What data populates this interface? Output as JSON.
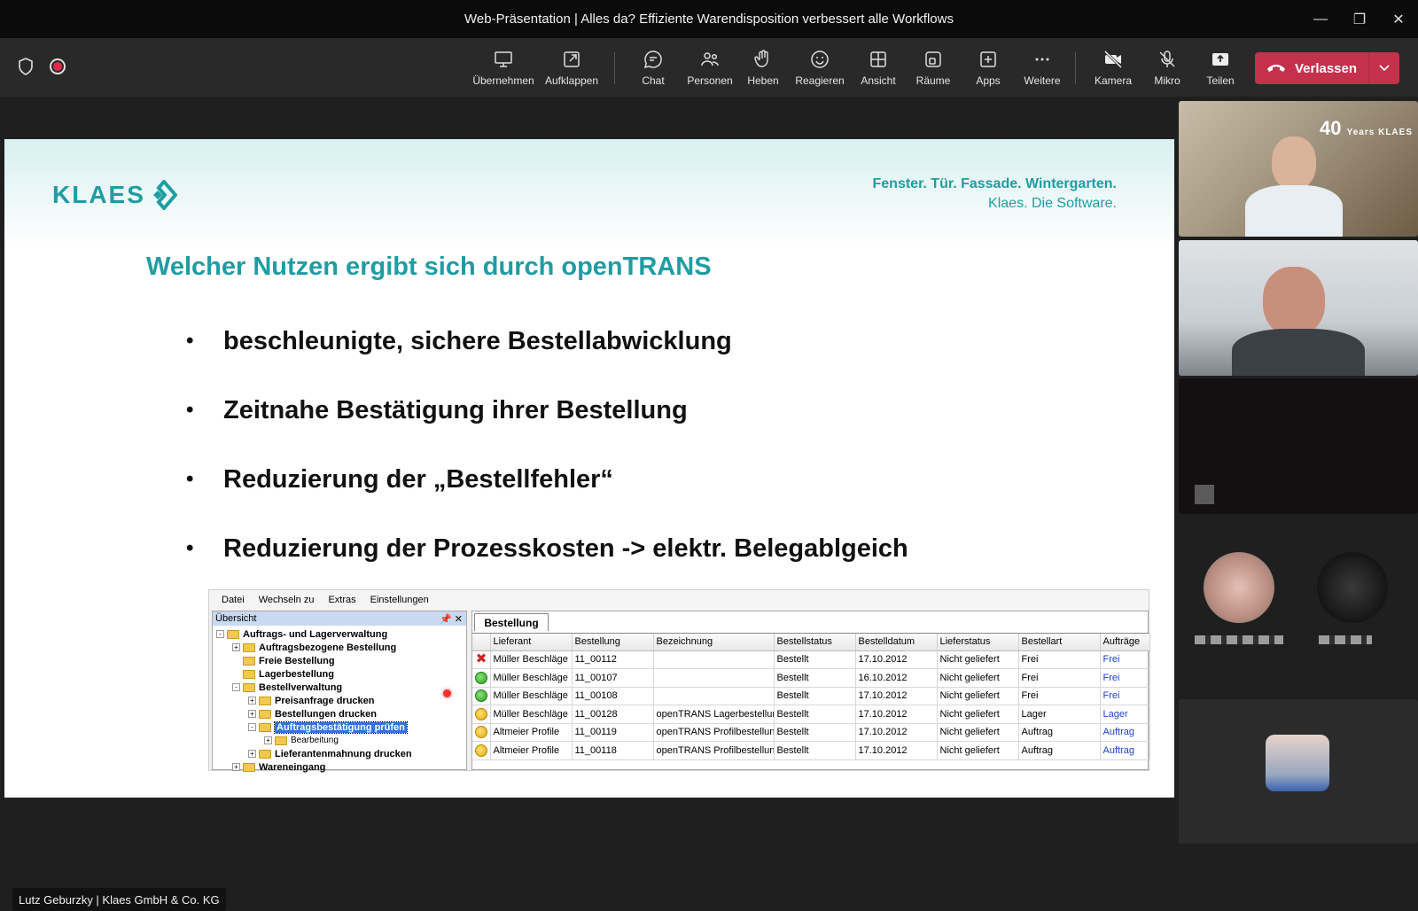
{
  "window": {
    "title": "Web-Präsentation | Alles da? Effiziente Warendisposition verbessert alle Workflows",
    "controls": [
      "minimize",
      "restore",
      "close"
    ]
  },
  "toolbar": {
    "buttons": [
      {
        "id": "share",
        "label": "Übernehmen",
        "icon": "screen-share-icon"
      },
      {
        "id": "popout",
        "label": "Aufklappen",
        "icon": "pop-out-icon"
      },
      {
        "id": "chat",
        "label": "Chat",
        "icon": "chat-icon"
      },
      {
        "id": "people",
        "label": "Personen",
        "icon": "people-icon"
      },
      {
        "id": "raise",
        "label": "Heben",
        "icon": "raise-hand-icon"
      },
      {
        "id": "react",
        "label": "Reagieren",
        "icon": "smiley-icon"
      },
      {
        "id": "view",
        "label": "Ansicht",
        "icon": "grid-view-icon"
      },
      {
        "id": "rooms",
        "label": "Räume",
        "icon": "breakout-rooms-icon"
      },
      {
        "id": "apps",
        "label": "Apps",
        "icon": "apps-plus-icon"
      },
      {
        "id": "more",
        "label": "Weitere",
        "icon": "more-icon"
      },
      {
        "id": "camera",
        "label": "Kamera",
        "icon": "camera-off-icon"
      },
      {
        "id": "mic",
        "label": "Mikro",
        "icon": "mic-off-icon"
      },
      {
        "id": "share2",
        "label": "Teilen",
        "icon": "share-tray-icon"
      }
    ],
    "leave_label": "Verlassen",
    "leave_color": "#c4314b"
  },
  "slide": {
    "logo": "KLAES",
    "tagline_1": "Fenster. Tür. Fassade. Wintergarten.",
    "tagline_2": "Klaes. Die Software.",
    "title": "Welcher Nutzen ergibt sich durch openTRANS",
    "accent": "#1f9da3",
    "bullets": [
      "beschleunigte, sichere Bestellabwicklung",
      "Zeitnahe Bestätigung ihrer Bestellung",
      "Reduzierung der „Bestellfehler“",
      "Reduzierung der Prozesskosten -> elektr. Belegablgeich"
    ]
  },
  "app": {
    "menu": [
      "Datei",
      "Wechseln zu",
      "Extras",
      "Einstellungen"
    ],
    "pane_title": "Übersicht",
    "tree": [
      {
        "label": "Auftrags- und Lagerverwaltung",
        "level": 0,
        "expander": "-"
      },
      {
        "label": "Auftragsbezogene Bestellung",
        "level": 1,
        "expander": "+"
      },
      {
        "label": "Freie Bestellung",
        "level": 1,
        "expander": ""
      },
      {
        "label": "Lagerbestellung",
        "level": 1,
        "expander": ""
      },
      {
        "label": "Bestellverwaltung",
        "level": 1,
        "expander": "-"
      },
      {
        "label": "Preisanfrage drucken",
        "level": 2,
        "expander": "+"
      },
      {
        "label": "Bestellungen drucken",
        "level": 2,
        "expander": "+"
      },
      {
        "label": "Auftragsbestätigung prüfen",
        "level": 2,
        "expander": "-",
        "selected": true
      },
      {
        "label": "Bearbeitung",
        "level": 3,
        "expander": "+",
        "small": true
      },
      {
        "label": "Lieferantenmahnung drucken",
        "level": 2,
        "expander": "+"
      },
      {
        "label": "Wareneingang",
        "level": 1,
        "expander": "+"
      }
    ],
    "tab": "Bestellung",
    "columns": [
      "",
      "Lieferant",
      "Bestellung",
      "Bezeichnung",
      "Bestellstatus",
      "Bestelldatum",
      "Lieferstatus",
      "Bestellart",
      "Aufträge"
    ],
    "rows": [
      {
        "status": "red",
        "lieferant": "Müller Beschläge",
        "bestellung": "11_00112",
        "bezeichnung": "",
        "bestellstatus": "Bestellt",
        "datum": "17.10.2012",
        "lieferstatus": "Nicht geliefert",
        "art": "Frei",
        "auftraege": "Frei"
      },
      {
        "status": "green",
        "lieferant": "Müller Beschläge",
        "bestellung": "11_00107",
        "bezeichnung": "",
        "bestellstatus": "Bestellt",
        "datum": "16.10.2012",
        "lieferstatus": "Nicht geliefert",
        "art": "Frei",
        "auftraege": "Frei"
      },
      {
        "status": "green",
        "lieferant": "Müller Beschläge",
        "bestellung": "11_00108",
        "bezeichnung": "",
        "bestellstatus": "Bestellt",
        "datum": "17.10.2012",
        "lieferstatus": "Nicht geliefert",
        "art": "Frei",
        "auftraege": "Frei"
      },
      {
        "status": "yellow",
        "lieferant": "Müller Beschläge",
        "bestellung": "11_00128",
        "bezeichnung": "openTRANS Lagerbestellung",
        "bestellstatus": "Bestellt",
        "datum": "17.10.2012",
        "lieferstatus": "Nicht geliefert",
        "art": "Lager",
        "auftraege": "Lager"
      },
      {
        "status": "yellow",
        "lieferant": "Altmeier Profile",
        "bestellung": "11_00119",
        "bezeichnung": "openTRANS Profilbestellung",
        "bestellstatus": "Bestellt",
        "datum": "17.10.2012",
        "lieferstatus": "Nicht geliefert",
        "art": "Auftrag",
        "auftraege": "Auftrag"
      },
      {
        "status": "yellow",
        "lieferant": "Altmeier Profile",
        "bestellung": "11_00118",
        "bezeichnung": "openTRANS Profilbestellung",
        "bestellstatus": "Bestellt",
        "datum": "17.10.2012",
        "lieferstatus": "Nicht geliefert",
        "art": "Auftrag",
        "auftraege": "Auftrag"
      }
    ]
  },
  "presenter": "Lutz Geburzky | Klaes GmbH & Co. KG",
  "side": {
    "tile1_badge_number": "40",
    "tile1_badge_text": "Years KLAES"
  }
}
